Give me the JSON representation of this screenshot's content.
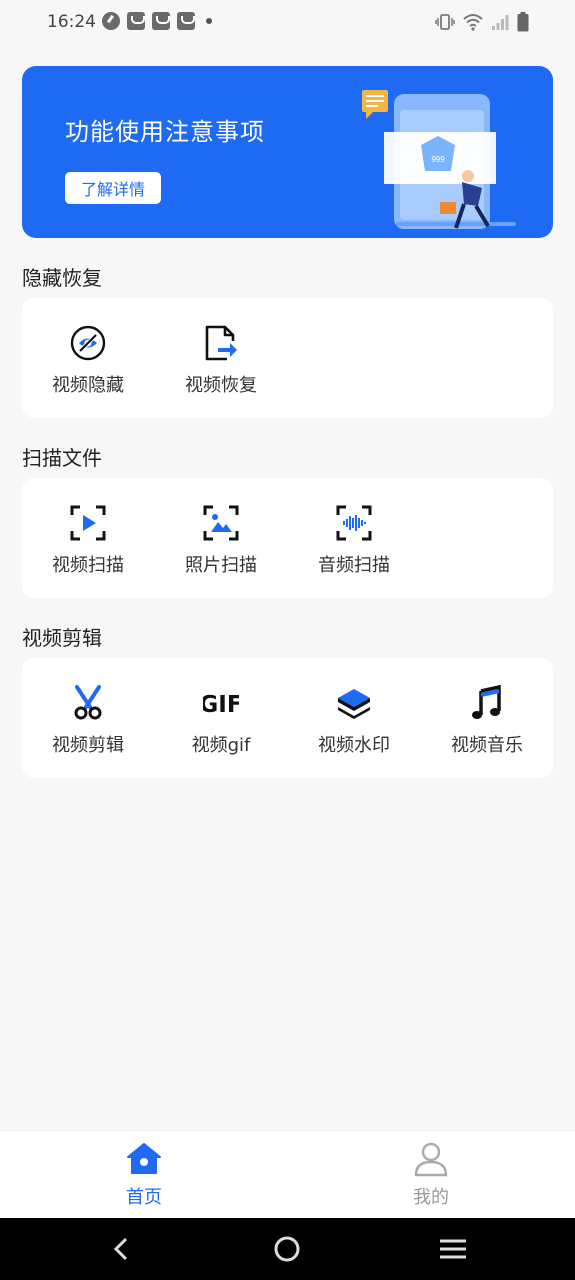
{
  "status_bar": {
    "time": "16:24",
    "left_icons": [
      "speedometer-icon",
      "bag-icon",
      "bag-icon",
      "bag-icon",
      "dot-icon"
    ],
    "right_icons": [
      "vibrate-icon",
      "wifi-icon",
      "signal-icon",
      "battery-icon"
    ]
  },
  "banner": {
    "title": "功能使用注意事项",
    "button_label": "了解详情",
    "illustration_badge": "999",
    "accent_color": "#1f6af3"
  },
  "sections": [
    {
      "title": "隐藏恢复",
      "items": [
        {
          "label": "视频隐藏",
          "icon": "eye-off-icon"
        },
        {
          "label": "视频恢复",
          "icon": "file-export-icon"
        }
      ]
    },
    {
      "title": "扫描文件",
      "items": [
        {
          "label": "视频扫描",
          "icon": "scan-video-icon"
        },
        {
          "label": "照片扫描",
          "icon": "scan-photo-icon"
        },
        {
          "label": "音频扫描",
          "icon": "scan-audio-icon"
        }
      ]
    },
    {
      "title": "视频剪辑",
      "items": [
        {
          "label": "视频剪辑",
          "icon": "scissors-icon"
        },
        {
          "label": "视频gif",
          "icon": "gif-icon",
          "icon_text": "GIF"
        },
        {
          "label": "视频水印",
          "icon": "layers-icon"
        },
        {
          "label": "视频音乐",
          "icon": "music-note-icon"
        }
      ]
    }
  ],
  "bottom_nav": {
    "items": [
      {
        "label": "首页",
        "icon": "home-icon",
        "active": true
      },
      {
        "label": "我的",
        "icon": "user-icon",
        "active": false
      }
    ]
  },
  "system_nav": [
    "back-icon",
    "home-circle-icon",
    "menu-icon"
  ]
}
